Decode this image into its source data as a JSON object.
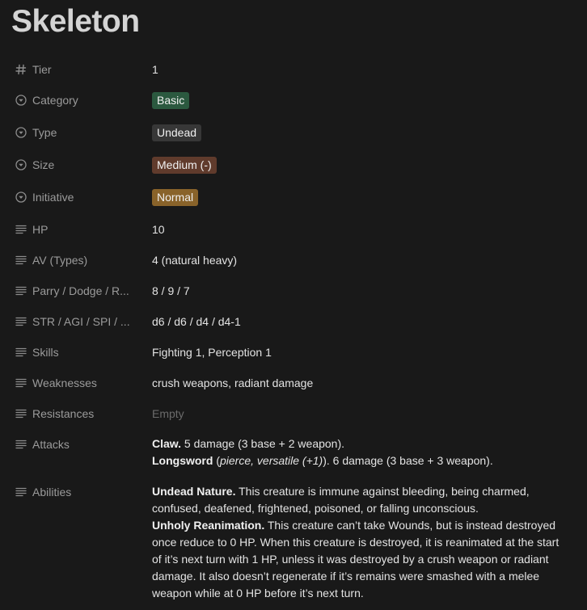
{
  "page": {
    "title": "Skeleton"
  },
  "properties": {
    "tier": {
      "label": "Tier",
      "value": "1"
    },
    "category": {
      "label": "Category",
      "value": "Basic",
      "color": "#2b593f"
    },
    "type": {
      "label": "Type",
      "value": "Undead",
      "color": "#373737"
    },
    "size": {
      "label": "Size",
      "value": "Medium (-)",
      "color": "#603b2c"
    },
    "initiative": {
      "label": "Initiative",
      "value": "Normal",
      "color": "#89632a"
    },
    "hp": {
      "label": "HP",
      "value": "10"
    },
    "av": {
      "label": "AV (Types)",
      "value": "4 (natural heavy)"
    },
    "parry": {
      "label": "Parry / Dodge / R...",
      "value": "8 / 9 / 7"
    },
    "stats": {
      "label": "STR / AGI / SPI / ...",
      "value": "d6 / d6 / d4 / d4-1"
    },
    "skills": {
      "label": "Skills",
      "value": "Fighting 1, Perception 1"
    },
    "weaknesses": {
      "label": "Weaknesses",
      "value": "crush weapons, radiant damage"
    },
    "resistances": {
      "label": "Resistances",
      "value": "Empty"
    },
    "attacks": {
      "label": "Attacks",
      "claw_name": "Claw.",
      "claw_text": " 5 damage (3 base + 2 weapon).",
      "longsword_name": "Longsword",
      "longsword_open": " (",
      "longsword_traits": "pierce, versatile (+1)",
      "longsword_text": "). 6 damage (3 base + 3 weapon)."
    },
    "abilities": {
      "label": "Abilities",
      "undead_name": "Undead Nature.",
      "undead_text": " This creature is immune against bleeding, being charmed, confused, deafened, frightened, poisoned, or falling unconscious.",
      "unholy_name": "Unholy Reanimation.",
      "unholy_text": " This creature can’t take Wounds, but is instead destroyed once reduce to 0 HP. When this creature is destroyed, it is reanimated at the start of it’s next turn with 1 HP, unless it was destroyed by a crush weapon or radiant damage. It also doesn’t regenerate if it’s remains were smashed with a melee weapon while at 0 HP before it’s next turn."
    }
  },
  "icons": {
    "number": "hash-icon",
    "select": "select-circle-icon",
    "text": "text-lines-icon"
  }
}
